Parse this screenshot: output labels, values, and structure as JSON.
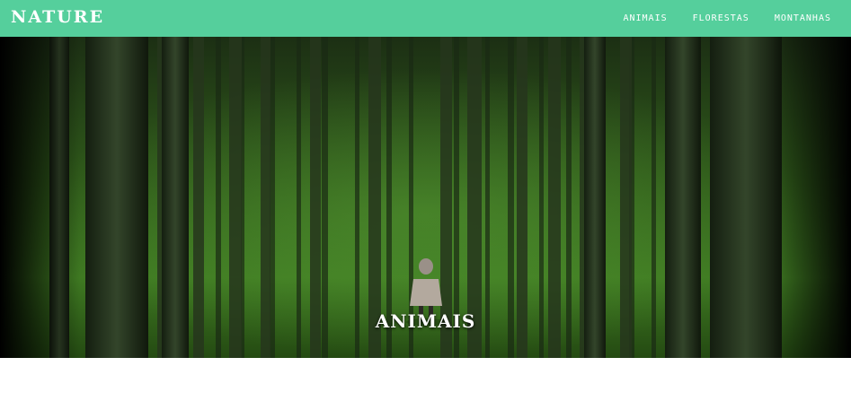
{
  "brand": {
    "name": "NATURE"
  },
  "nav": {
    "items": [
      "ANIMAIS",
      "FLORESTAS",
      "MONTANHAS"
    ]
  },
  "hero": {
    "title": "ANIMAIS",
    "image_subject": "person in a mossy pine forest"
  },
  "colors": {
    "navbar": "#55cf9c",
    "text": "#ffffff",
    "forest_dark": "#0b1408",
    "moss": "#3f7a22"
  }
}
